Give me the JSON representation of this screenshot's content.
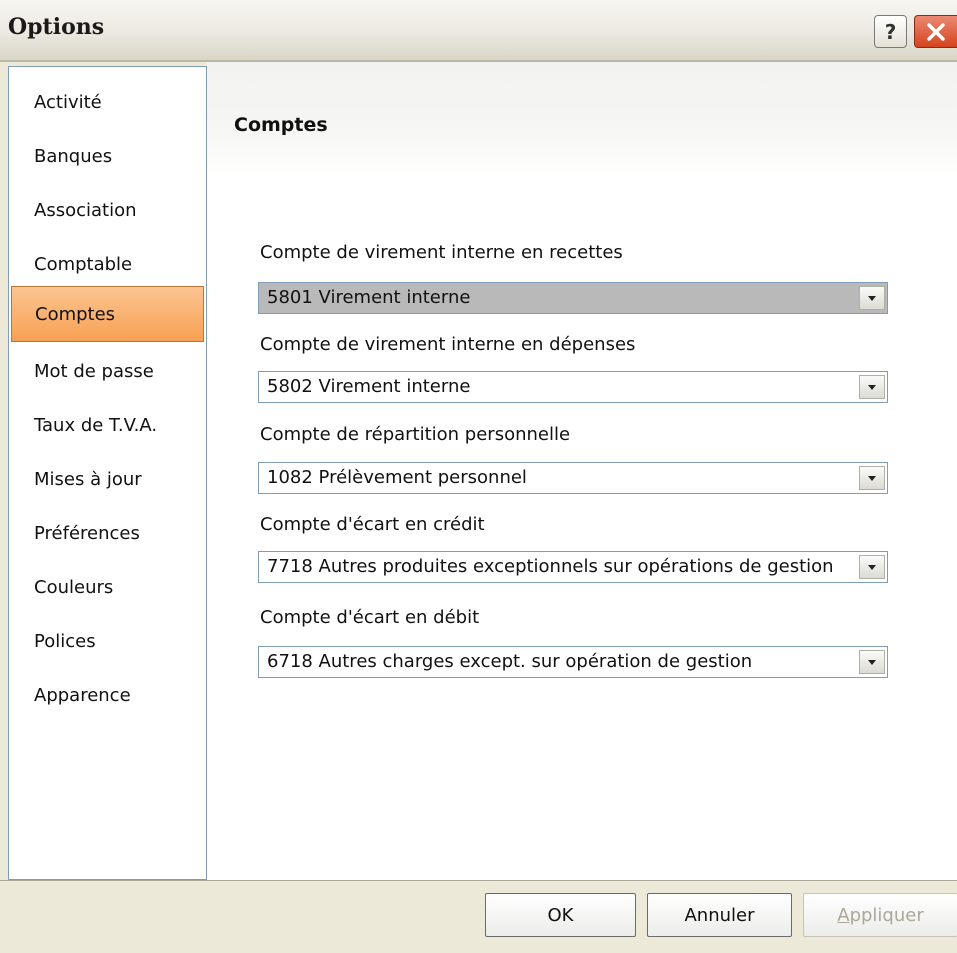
{
  "window": {
    "title": "Options"
  },
  "titlebar": {
    "help_label": "?"
  },
  "nav": {
    "items": [
      {
        "label": "Activité"
      },
      {
        "label": "Banques"
      },
      {
        "label": "Association"
      },
      {
        "label": "Comptable"
      },
      {
        "label": "Comptes",
        "selected": true
      },
      {
        "label": "Mot de passe"
      },
      {
        "label": "Taux de T.V.A."
      },
      {
        "label": "Mises à jour"
      },
      {
        "label": "Préférences"
      },
      {
        "label": "Couleurs"
      },
      {
        "label": "Polices"
      },
      {
        "label": "Apparence"
      }
    ]
  },
  "section": {
    "title": "Comptes",
    "fields": [
      {
        "label": "Compte de virement interne en recettes",
        "value": "5801 Virement interne"
      },
      {
        "label": "Compte de virement interne en dépenses",
        "value": "5802 Virement interne"
      },
      {
        "label": "Compte de répartition personnelle",
        "value": "1082 Prélèvement personnel"
      },
      {
        "label": "Compte d'écart en crédit",
        "value": "7718 Autres produites exceptionnels sur opérations de gestion"
      },
      {
        "label": "Compte d'écart en débit",
        "value": "6718 Autres charges except. sur opération de gestion"
      }
    ]
  },
  "footer": {
    "ok_label": "OK",
    "cancel_label": "Annuler",
    "apply_mnemonic": "A",
    "apply_rest": "ppliquer"
  },
  "colors": {
    "selected_item": "#f7a153",
    "window_bg": "#ece9d8",
    "close_button": "#d5431f"
  }
}
